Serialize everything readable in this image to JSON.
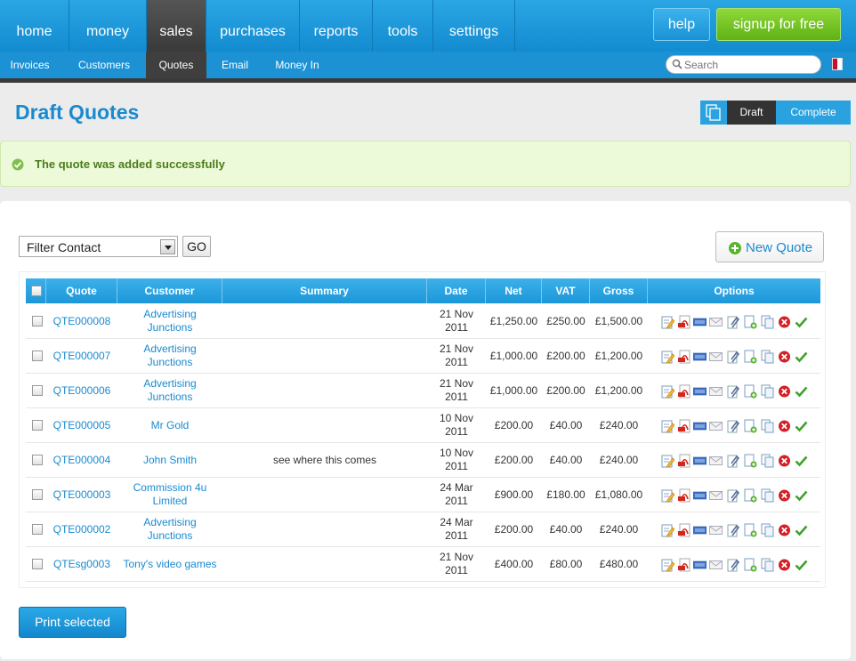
{
  "topnav": {
    "items": [
      {
        "label": "home",
        "active": false
      },
      {
        "label": "money",
        "active": false
      },
      {
        "label": "sales",
        "active": true
      },
      {
        "label": "purchases",
        "active": false
      },
      {
        "label": "reports",
        "active": false
      },
      {
        "label": "tools",
        "active": false
      },
      {
        "label": "settings",
        "active": false
      }
    ],
    "help_label": "help",
    "signup_label": "signup for free"
  },
  "subnav": {
    "items": [
      {
        "label": "Invoices",
        "active": false
      },
      {
        "label": "Customers",
        "active": false
      },
      {
        "label": "Quotes",
        "active": true
      },
      {
        "label": "Email",
        "active": false
      },
      {
        "label": "Money In",
        "active": false
      }
    ],
    "search_placeholder": "Search"
  },
  "page": {
    "title": "Draft Quotes",
    "toggle": {
      "draft": "Draft",
      "complete": "Complete"
    },
    "notice": "The quote was added successfully"
  },
  "filter": {
    "selected": "Filter Contact",
    "go_label": "GO",
    "new_quote_label": "New Quote"
  },
  "table": {
    "headers": [
      "Quote",
      "Customer",
      "Summary",
      "Date",
      "Net",
      "VAT",
      "Gross",
      "Options"
    ],
    "rows": [
      {
        "quote": "QTE000008",
        "customer": "Advertising Junctions",
        "summary": "",
        "date": "21 Nov 2011",
        "net": "£1,250.00",
        "vat": "£250.00",
        "gross": "£1,500.00"
      },
      {
        "quote": "QTE000007",
        "customer": "Advertising Junctions",
        "summary": "",
        "date": "21 Nov 2011",
        "net": "£1,000.00",
        "vat": "£200.00",
        "gross": "£1,200.00"
      },
      {
        "quote": "QTE000006",
        "customer": "Advertising Junctions",
        "summary": "",
        "date": "21 Nov 2011",
        "net": "£1,000.00",
        "vat": "£200.00",
        "gross": "£1,200.00"
      },
      {
        "quote": "QTE000005",
        "customer": "Mr Gold",
        "summary": "",
        "date": "10 Nov 2011",
        "net": "£200.00",
        "vat": "£40.00",
        "gross": "£240.00"
      },
      {
        "quote": "QTE000004",
        "customer": "John Smith",
        "summary": "see where this comes",
        "date": "10 Nov 2011",
        "net": "£200.00",
        "vat": "£40.00",
        "gross": "£240.00"
      },
      {
        "quote": "QTE000003",
        "customer": "Commission 4u Limited",
        "summary": "",
        "date": "24 Mar 2011",
        "net": "£900.00",
        "vat": "£180.00",
        "gross": "£1,080.00"
      },
      {
        "quote": "QTE000002",
        "customer": "Advertising Junctions",
        "summary": "",
        "date": "24 Mar 2011",
        "net": "£200.00",
        "vat": "£40.00",
        "gross": "£240.00"
      },
      {
        "quote": "QTEsg0003",
        "customer": "Tony's video games",
        "summary": "",
        "date": "21 Nov 2011",
        "net": "£400.00",
        "vat": "£80.00",
        "gross": "£480.00"
      }
    ],
    "option_icons": [
      "edit-icon",
      "pdf-icon",
      "html-icon",
      "email-icon",
      "attach-icon",
      "convert-invoice-icon",
      "copy-icon",
      "delete-icon",
      "complete-check-icon"
    ]
  },
  "actions": {
    "print_selected_label": "Print selected"
  }
}
